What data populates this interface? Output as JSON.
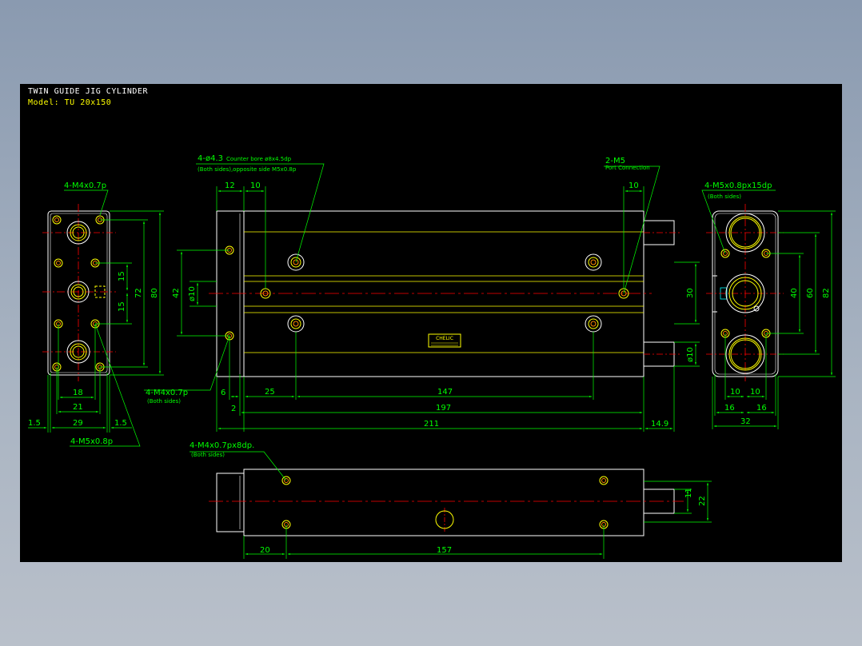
{
  "header": {
    "title": "TWIN GUIDE JIG CYLINDER",
    "model": "Model: TU 20x150"
  },
  "colors": {
    "outline": "#ffffff",
    "dimension": "#00ff00",
    "centerline": "#ff0000",
    "detail": "#ffff00",
    "hole": "#ff8800"
  },
  "notes": {
    "left_top": "4-M4x0.7p",
    "left_bottom": "4-M5x0.8p",
    "front_counterbore_1": "4-ø4.3",
    "front_counterbore_2": "Counter bore ø8x4.5dp",
    "front_counterbore_3": "(Both sides),opposite side M5x0.8p",
    "port_1": "2-M5",
    "port_2": "Port Connection",
    "front_bottom_1": "4-M4x0.7p",
    "front_bottom_2": "(Both sides)",
    "right_1": "4-M5x0.8px15dp",
    "right_2": "(Both sides)",
    "bottom_view_1": "4-M4x0.7px8dp.",
    "bottom_view_2": "(Both sides)",
    "label_text": "CHELIC"
  },
  "dimensions": {
    "left_view": {
      "d15a": "15",
      "d15b": "15",
      "d72": "72",
      "d80": "80",
      "d18": "18",
      "d21": "21",
      "d29": "29",
      "d1_5a": "1.5",
      "d1_5b": "1.5"
    },
    "front_view": {
      "d12": "12",
      "d10a": "10",
      "d10b": "10",
      "d42": "42",
      "d_phi10a": "ø10",
      "d30": "30",
      "d_phi10b": "ø10",
      "d6": "6",
      "d25": "25",
      "d147": "147",
      "d2": "2",
      "d197": "197",
      "d211": "211",
      "d14_9": "14.9"
    },
    "right_view": {
      "d40": "40",
      "d60": "60",
      "d82": "82",
      "d10a": "10",
      "d10b": "10",
      "d16a": "16",
      "d16b": "16",
      "d32": "32"
    },
    "bottom_view": {
      "d11": "11",
      "d22": "22",
      "d20": "20",
      "d157": "157"
    }
  }
}
